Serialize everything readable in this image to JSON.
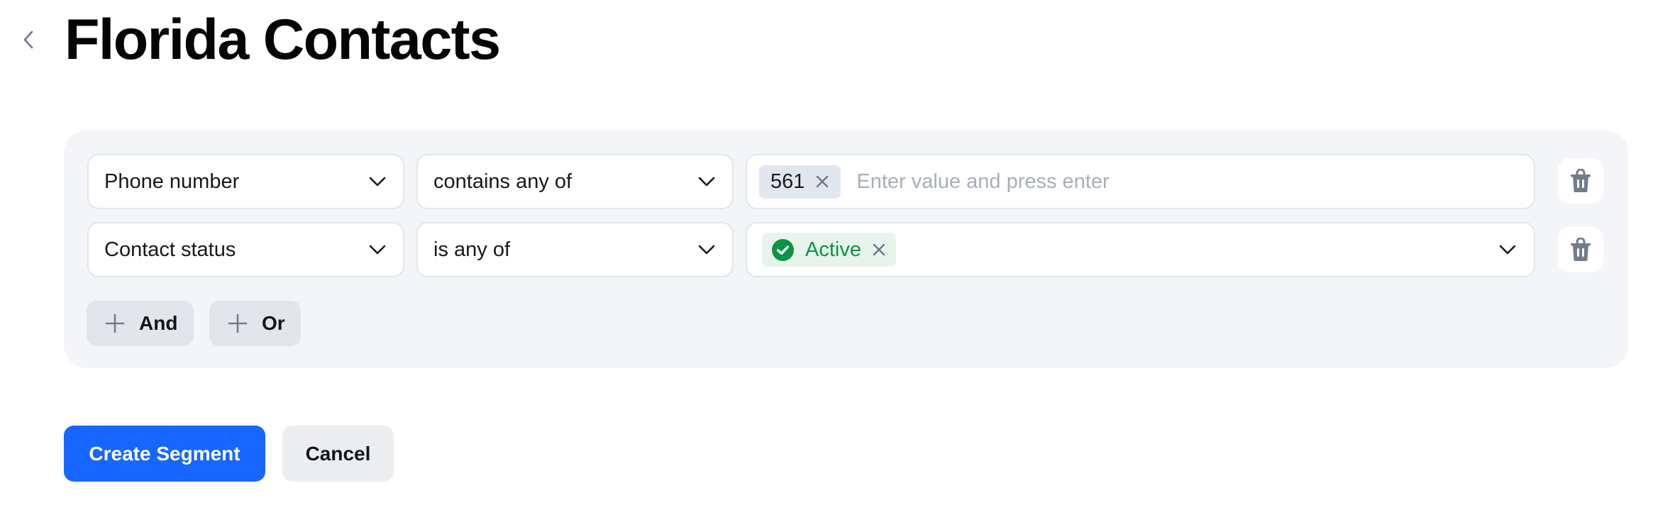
{
  "header": {
    "back_icon": "chevron-left-icon",
    "title": "Florida Contacts"
  },
  "filters": {
    "rows": [
      {
        "property": "Phone number",
        "operator": "contains any of",
        "value_type": "text-tags",
        "tags": [
          {
            "label": "561",
            "remove_icon": "close-icon"
          }
        ],
        "input_value": "",
        "placeholder": "Enter value and press enter",
        "delete_icon": "trash-icon"
      },
      {
        "property": "Contact status",
        "operator": "is any of",
        "value_type": "select-tags",
        "tags": [
          {
            "label": "Active",
            "status_icon": "check-circle-icon",
            "remove_icon": "close-icon"
          }
        ],
        "delete_icon": "trash-icon"
      }
    ],
    "add_and_label": "And",
    "add_or_label": "Or",
    "add_icon": "plus-icon"
  },
  "actions": {
    "primary_label": "Create Segment",
    "secondary_label": "Cancel"
  },
  "colors": {
    "primary": "#1766ff",
    "panel_bg": "#f3f5f8",
    "active_green": "#0b9444",
    "active_bg": "#e7f4ec",
    "tag_bg": "#e2e7ef",
    "icon_gray": "#737c89"
  }
}
